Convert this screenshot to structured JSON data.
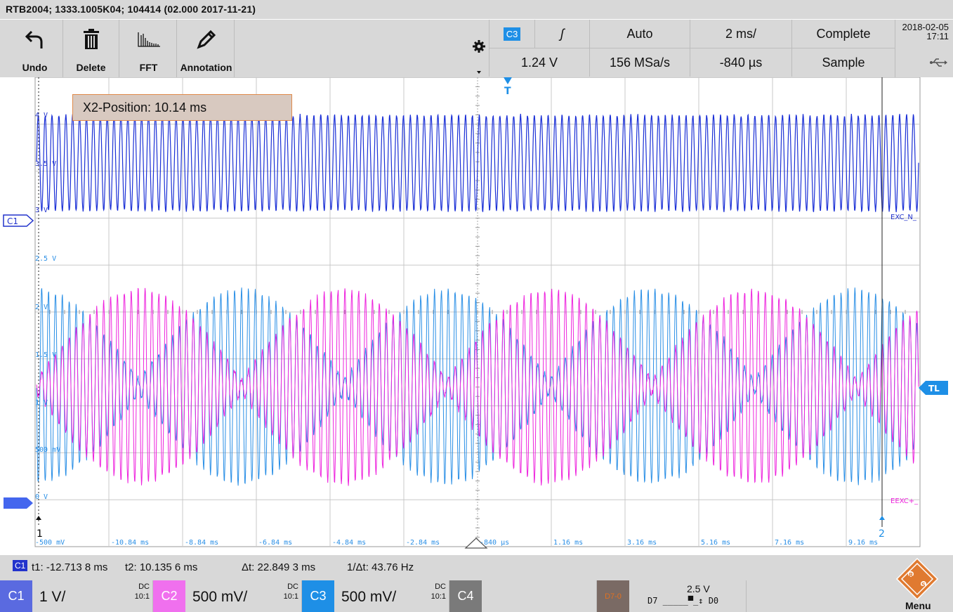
{
  "titlebar": {
    "text": "RTB2004; 1333.1005K04; 104414 (02.000 2017-11-21)"
  },
  "toolbar": {
    "undo": "Undo",
    "delete": "Delete",
    "fft": "FFT",
    "annotation": "Annotation"
  },
  "trigger_panel": {
    "source": "C3",
    "edge": "ʃ",
    "mode": "Auto",
    "timebase": "2 ms/",
    "acq_status": "Complete",
    "level": "1.24 V",
    "sample_rate": "156 MSa/s",
    "offset": "-840 µs",
    "acq_mode": "Sample"
  },
  "datetime": {
    "date": "2018-02-05",
    "time": "17:11"
  },
  "cursor_readout": "X2-Position: 10.14 ms",
  "markers": {
    "trigger": "T",
    "c1": "C1",
    "tl": "TL",
    "cursor1": "1",
    "cursor2": "2",
    "exc_n": "EXC_N_",
    "eexc": "EEXC+_"
  },
  "y_labels": {
    "c1_top": "4 V",
    "c1_mid": "3.5 V",
    "c1_bot": "3 V",
    "l25": "2.5 V",
    "l2": "2 V",
    "l15": "1.5 V",
    "l1": "1 V",
    "l500": "500 mV",
    "l0": "0 V",
    "lm500": "-500 mV"
  },
  "x_labels": [
    "-10.84 ms",
    "-8.84 ms",
    "-6.84 ms",
    "-4.84 ms",
    "-2.84 ms",
    "-840 µs",
    "1.16 ms",
    "3.16 ms",
    "5.16 ms",
    "7.16 ms",
    "9.16 ms"
  ],
  "measurements": {
    "source": "C1",
    "t1": "t1: -12.713 8 ms",
    "t2": "t2: 10.135 6 ms",
    "dt": "Δt: 22.849 3 ms",
    "inv_dt": "1/Δt: 43.76 Hz"
  },
  "channels": [
    {
      "name": "C1",
      "scale": "1 V/",
      "coupling": "DC",
      "probe": "10:1",
      "color": "#4a5cd6"
    },
    {
      "name": "C2",
      "scale": "500 mV/",
      "coupling": "DC",
      "probe": "10:1",
      "color": "#ee55ee"
    },
    {
      "name": "C3",
      "scale": "500 mV/",
      "coupling": "DC",
      "probe": "10:1",
      "color": "#1e8fe6"
    },
    {
      "name": "C4",
      "scale": "",
      "coupling": "",
      "probe": "",
      "color": "#7a7a7a"
    }
  ],
  "logic": {
    "name": "D7-0",
    "threshold": "2.5 V",
    "d7": "D7",
    "d0": "D0"
  },
  "menu": {
    "label": "Menu"
  },
  "colors": {
    "ch1": "#1a2fd6",
    "ch2": "#ee22dd",
    "ch3": "#2a8fe6",
    "grid": "#b8b8b8",
    "accent": "#1e8fe6"
  }
}
